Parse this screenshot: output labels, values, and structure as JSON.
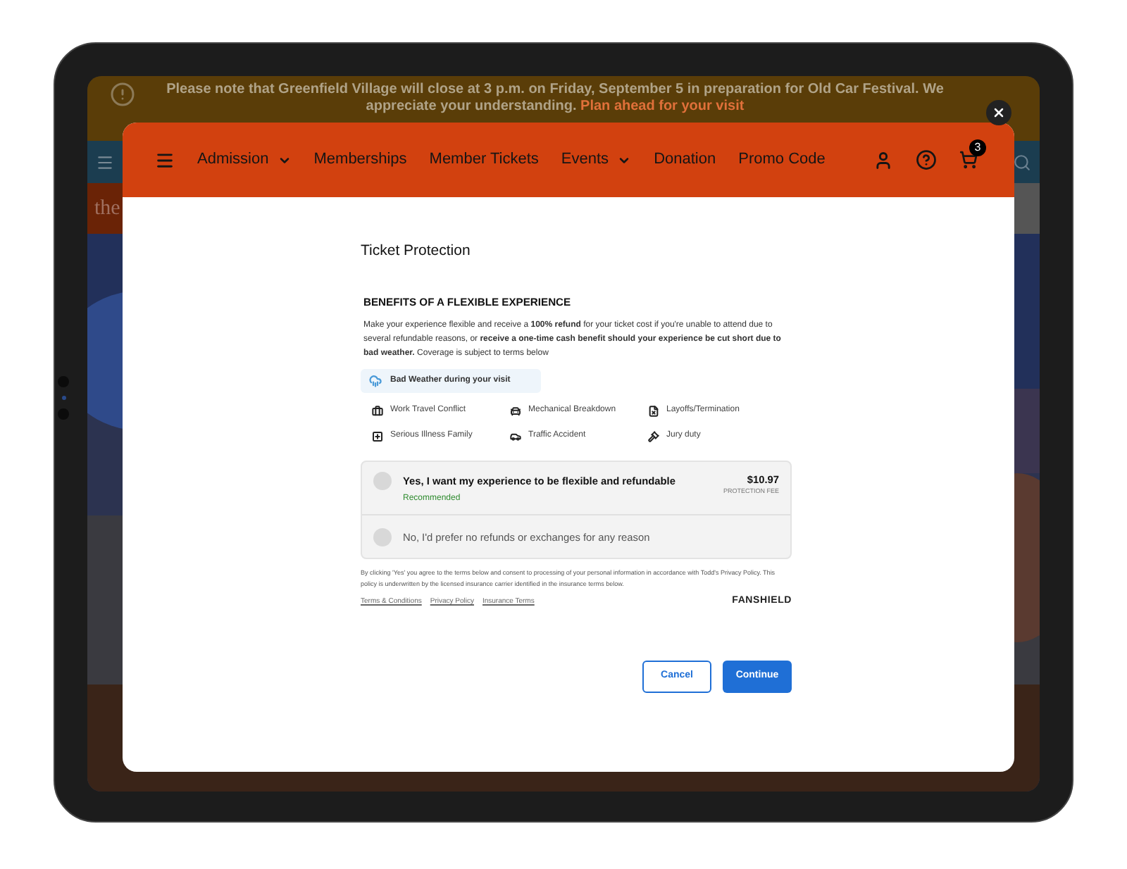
{
  "background_page": {
    "alert_banner": {
      "text": "Please note that Greenfield Village will close at 3 p.m. on Friday, September 5 in preparation for Old Car Festival. We appreciate your understanding.",
      "link": "Plan ahead for your visit"
    },
    "hero_text": "the"
  },
  "modal": {
    "nav": {
      "items": [
        {
          "label": "Admission",
          "kind": "dropdown"
        },
        {
          "label": "Memberships",
          "kind": "link"
        },
        {
          "label": "Member Tickets",
          "kind": "link"
        },
        {
          "label": "Events",
          "kind": "dropdown"
        },
        {
          "label": "Donation",
          "kind": "link"
        },
        {
          "label": "Promo Code",
          "kind": "link"
        }
      ],
      "cart_count": "3"
    },
    "title": "Ticket Protection",
    "heading": "BENEFITS OF A FLEXIBLE EXPERIENCE",
    "description": "Make your experience flexible and receive a **100% refund** for your ticket cost if you're unable to attend due to several refundable reasons, or **receive a one-time cash benefit should your experience be cut short due to bad weather.** Coverage is subject to terms below",
    "featured_benefit": "Bad Weather during your visit",
    "benefits": [
      "Work Travel Conflict",
      "Mechanical Breakdown",
      "Layoffs/Termination",
      "Serious Illness Family",
      "Traffic Accident",
      "Jury duty"
    ],
    "options": [
      {
        "label": "Yes, I want my experience to be flexible and refundable",
        "sub": "Recommended",
        "price": "$10.97",
        "price_note": "PROTECTION FEE",
        "selected": false
      },
      {
        "label": "No, I'd prefer no refunds or exchanges for any reason",
        "selected": false
      }
    ],
    "disclaimer": "By clicking 'Yes' you agree to the terms below and consent to processing of your personal information in accordance with Todd's Privacy Policy. This policy is underwritten by the licensed insurance carrier identified in the insurance terms below.",
    "links": [
      "Terms & Conditions",
      "Privacy Policy",
      "Insurance Terms"
    ],
    "brand": "FANSHIELD",
    "buttons": [
      {
        "label": "Cancel",
        "kind": "secondary"
      },
      {
        "label": "Continue",
        "kind": "primary"
      }
    ]
  }
}
